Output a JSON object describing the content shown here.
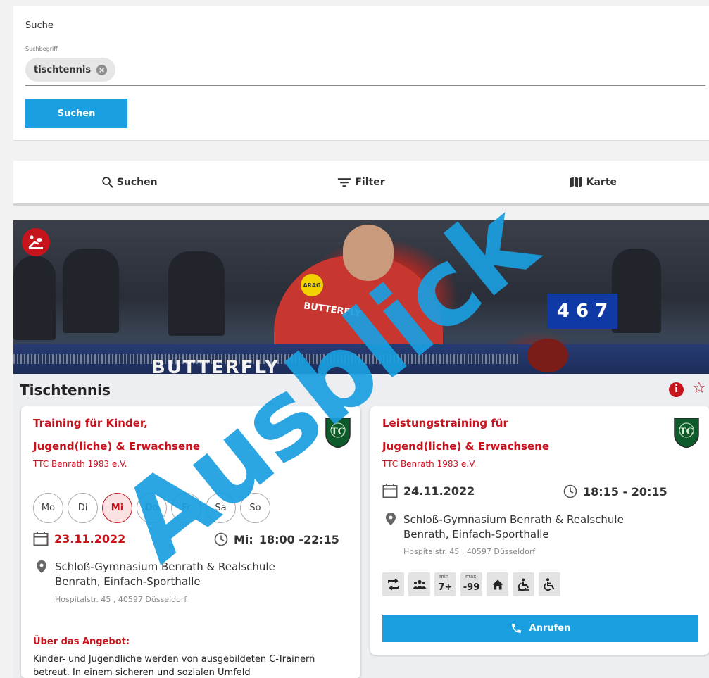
{
  "search": {
    "title": "Suche",
    "field_label": "Suchbegriff",
    "chip_value": "tischtennis",
    "button_label": "Suchen"
  },
  "tabs": [
    {
      "label": "Suchen",
      "icon": "search-icon"
    },
    {
      "label": "Filter",
      "icon": "filter-icon"
    },
    {
      "label": "Karte",
      "icon": "map-icon"
    }
  ],
  "hero": {
    "board_text": "BUTTERFLY",
    "shirt_text": "BUTTERFLY",
    "sponsor_badge": "ARAG",
    "scoreboard": "4 6 7",
    "sport_icon": "table-tennis-icon"
  },
  "section": {
    "title": "Tischtennis"
  },
  "card1": {
    "title_line1": "Training für Kinder,",
    "title_line2": "Jugend(liche) & Erwachsene",
    "club": "TTC Benrath 1983 e.V.",
    "days": [
      "Mo",
      "Di",
      "Mi",
      "Do",
      "Fr",
      "Sa",
      "So"
    ],
    "active_day": "Mi",
    "date": "23.11.2022",
    "time_day": "Mi:",
    "time": "18:00 -22:15",
    "venue_line1": "Schloß-Gymnasium Benrath & Realschule",
    "venue_line2": "Benrath, Einfach-Sporthalle",
    "street": "Hospitalstr. 45 , 40597 Düsseldorf",
    "about_heading": "Über das Angebot:",
    "about_text": "Kinder- und Jugendliche werden von ausgebildeten C-Trainern betreut. In einem sicheren und sozialen Umfeld"
  },
  "card2": {
    "title_line1": "Leistungstraining für",
    "title_line2": "Jugend(liche) & Erwachsene",
    "club": "TTC Benrath 1983 e.V.",
    "date": "24.11.2022",
    "time": "18:15 - 20:15",
    "venue_line1": "Schloß-Gymnasium Benrath & Realschule",
    "venue_line2": "Benrath, Einfach-Sporthalle",
    "street": "Hospitalstr. 45 , 40597 Düsseldorf",
    "features": {
      "min_label": "min",
      "min_value": "7+",
      "max_label": "max",
      "max_value": "-99"
    },
    "call_label": "Anrufen"
  },
  "watermark": "Ausblick",
  "colors": {
    "accent_blue": "#1a9fe0",
    "brand_red": "#c5141c",
    "club_green": "#0d5a2a"
  }
}
